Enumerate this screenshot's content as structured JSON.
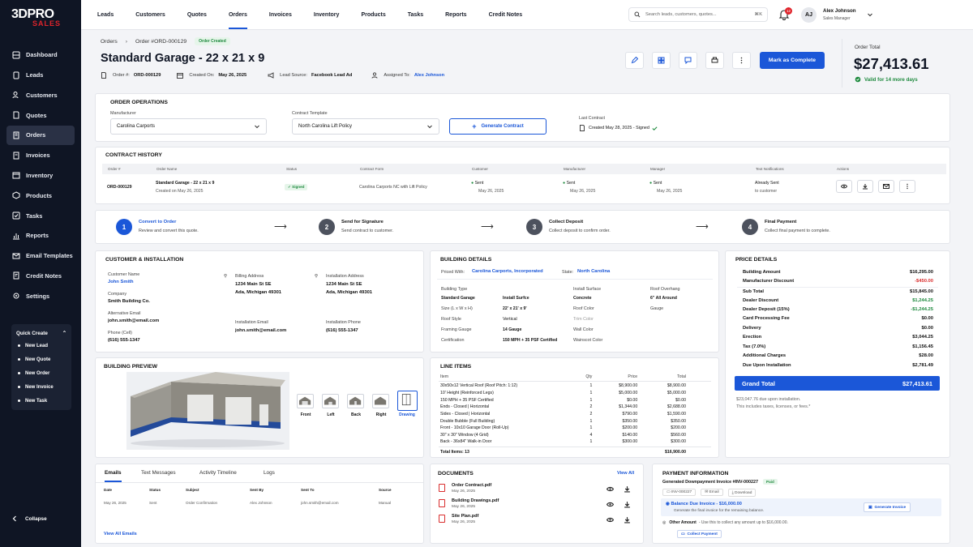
{
  "sidebar": {
    "logo_main": "3DPRO",
    "logo_sub": "SALES",
    "items": [
      {
        "label": "Dashboard",
        "icon": "dashboard-icon"
      },
      {
        "label": "Leads",
        "icon": "leads-icon"
      },
      {
        "label": "Customers",
        "icon": "customers-icon"
      },
      {
        "label": "Quotes",
        "icon": "quotes-icon"
      },
      {
        "label": "Orders",
        "icon": "orders-icon",
        "active": true
      },
      {
        "label": "Invoices",
        "icon": "invoices-icon"
      },
      {
        "label": "Inventory",
        "icon": "inventory-icon"
      },
      {
        "label": "Products",
        "icon": "products-icon"
      },
      {
        "label": "Tasks",
        "icon": "tasks-icon"
      },
      {
        "label": "Reports",
        "icon": "reports-icon"
      },
      {
        "label": "Email Templates",
        "icon": "email-templates-icon"
      },
      {
        "label": "Credit Notes",
        "icon": "credit-notes-icon"
      },
      {
        "label": "Settings",
        "icon": "settings-icon"
      }
    ],
    "quick_create": {
      "title": "Quick Create",
      "items": [
        "New Lead",
        "New Quote",
        "New Order",
        "New Invoice",
        "New Task"
      ]
    },
    "collapse_label": "Collapse"
  },
  "topnav": {
    "items": [
      "Leads",
      "Customers",
      "Quotes",
      "Orders",
      "Invoices",
      "Inventory",
      "Products",
      "Tasks",
      "Reports",
      "Credit Notes"
    ],
    "active": "Orders"
  },
  "search": {
    "placeholder": "Search leads, customers, quotes...",
    "shortcut": "⌘K"
  },
  "notifications": {
    "count": "12"
  },
  "user": {
    "initials": "AJ",
    "name": "Alex Johnson",
    "role": "Sales Manager"
  },
  "breadcrumb": {
    "root": "Orders",
    "current": "Order #ORD-000129",
    "status": "Order Created"
  },
  "order": {
    "title": "Standard Garage - 22 x 21 x 9",
    "number_label": "Order #:",
    "number": "ORD-000129",
    "created_label": "Created On:",
    "created": "May 26, 2025",
    "source_label": "Lead Source:",
    "source": "Facebook Lead Ad",
    "assigned_label": "Assigned To:",
    "assigned": "Alex Johnson",
    "mark_complete": "Mark as Complete"
  },
  "order_total": {
    "label": "Order Total",
    "value": "$27,413.61",
    "valid": "Valid for 14 more days"
  },
  "operations": {
    "title": "ORDER OPERATIONS",
    "manufacturer_label": "Manufacturer",
    "manufacturer": "Carolina Carports",
    "template_label": "Contract Template",
    "template": "North Carolina Lift Policy",
    "generate": "Generate Contract",
    "last_label": "Last Contract",
    "last": "Created May 28, 2025 - Signed"
  },
  "contract_history": {
    "title": "CONTRACT HISTORY",
    "headers": [
      "Order #",
      "Order Name",
      "Status",
      "Contract Form",
      "Customer",
      "Manufacturer",
      "Manager",
      "Text Notifications",
      "Actions"
    ],
    "row": {
      "order": "ORD-000129",
      "name": "Standard Garage - 22 x 21 x 9",
      "name_date": "Created on May 26, 2025",
      "status": "Signed",
      "form": "Carolina Carports NC with Lift Policy",
      "customer": "Sent",
      "customer_date": "May 26, 2025",
      "manufacturer": "Sent",
      "manufacturer_date": "May 26, 2025",
      "manager": "Sent",
      "manager_date": "May 26, 2025",
      "notif": "Already Sent",
      "notif_sub": "to customer"
    }
  },
  "steps": [
    {
      "n": "1",
      "title": "Convert to Order",
      "sub": "Review and convert this quote."
    },
    {
      "n": "2",
      "title": "Send for Signature",
      "sub": "Send contract to customer."
    },
    {
      "n": "3",
      "title": "Collect Deposit",
      "sub": "Collect deposit to confirm order."
    },
    {
      "n": "4",
      "title": "Final Payment",
      "sub": "Collect final payment to complete."
    }
  ],
  "customer": {
    "title": "CUSTOMER & INSTALLATION",
    "name_label": "Customer Name",
    "name": "John Smith",
    "company_label": "Company",
    "company": "Smith Building Co.",
    "alt_email_label": "Alternative Email",
    "alt_email": "john.smith@email.com",
    "phone_label": "Phone (Cell)",
    "phone": "(616) 555-1347",
    "billing_label": "Billing Address",
    "billing_1": "1234 Main St SE",
    "billing_2": "Ada, Michigan 49301",
    "install_label": "Installation Address",
    "install_1": "1234 Main St SE",
    "install_2": "Ada, Michigan 49301",
    "install_email_label": "Installation Email",
    "install_email": "john.smith@email.com",
    "install_phone_label": "Installation Phone",
    "install_phone": "(616) 555-1347"
  },
  "building": {
    "title": "BUILDING DETAILS",
    "priced_label": "Priced With:",
    "priced": "Carolina Carports, Incorporated",
    "state_label": "State:",
    "state": "North Carolina",
    "type_label": "Building Type",
    "type": "Standard Garage",
    "size_label": "Size (L x W x H)",
    "size": "22' x 21' x 9'",
    "roof_label": "Roof Style",
    "roof": "Vertical",
    "gauge_label": "Framing Gauge",
    "gauge": "14 Gauge",
    "cert_label": "Certification",
    "cert": "150 MPH + 35 PSF Certified",
    "surface_label": "Install Surface",
    "surface": "Concrete",
    "roofcolor_label": "Roof Color",
    "trim_label": "Trim Color",
    "wall_label": "Wall Color",
    "wainscot_label": "Wainscot Color",
    "overhang_label": "Roof Overhang",
    "overhang": "6\" All Around",
    "gauge2": "Gauge"
  },
  "price": {
    "title": "PRICE DETAILS",
    "rows": [
      {
        "k": "Building Amount",
        "v": "$16,295.00",
        "c": ""
      },
      {
        "k": "Manufacturer Discount",
        "v": "-$450.00",
        "c": "neg"
      },
      {
        "k": "Sub Total",
        "v": "$15,845.00",
        "c": ""
      },
      {
        "k": "Dealer Discount",
        "v": "$1,244.25",
        "c": "pos"
      },
      {
        "k": "Dealer Deposit (15%)",
        "v": "-$1,244.25",
        "c": "pos"
      },
      {
        "k": "Card Processing Fee",
        "v": "$0.00",
        "c": ""
      },
      {
        "k": "Delivery",
        "v": "$0.00",
        "c": ""
      },
      {
        "k": "Erection",
        "v": "$3,044.25",
        "c": ""
      },
      {
        "k": "Tax (7.0%)",
        "v": "$1,156.45",
        "c": ""
      },
      {
        "k": "Additional Charges",
        "v": "$28.00",
        "c": ""
      },
      {
        "k": "Due Upon Installation",
        "v": "$2,781.49",
        "c": ""
      }
    ],
    "grand_label": "Grand Total",
    "grand": "$27,413.61",
    "note1": "$23,047.76 due upon installation.",
    "note2": "This includes taxes, licenses, or fees.*"
  },
  "preview": {
    "title": "BUILDING PREVIEW",
    "views": [
      "Front",
      "Left",
      "Back",
      "Right",
      "Drawing"
    ]
  },
  "line_items": {
    "title": "LINE ITEMS",
    "headers": [
      "Item",
      "Qty",
      "Price",
      "Total"
    ],
    "rows": [
      [
        "30x50x12 Vertical Roof (Roof Pitch: 1:12)",
        "1",
        "$8,900.00",
        "$8,900.00"
      ],
      [
        "10' Height (Reinforced Legs)",
        "1",
        "$5,000.00",
        "$5,000.00"
      ],
      [
        "150 MPH + 35 PSF Certified",
        "1",
        "$0.00",
        "$0.00"
      ],
      [
        "Ends - Closed | Horizontal",
        "2",
        "$1,344.00",
        "$2,688.00"
      ],
      [
        "Sides - Closed | Horizontal",
        "2",
        "$790.00",
        "$1,590.00"
      ],
      [
        "Double Bubble (Full Building)",
        "1",
        "$350.00",
        "$350.00"
      ],
      [
        "Front - 10x10 Garage Door (Roll-Up)",
        "1",
        "$200.00",
        "$200.00"
      ],
      [
        "30\" x 30\" Window (4 Grid)",
        "4",
        "$140.00",
        "$560.00"
      ],
      [
        "Back - 36x84\" Walk-in Door",
        "1",
        "$300.00",
        "$300.00"
      ]
    ],
    "total_items": "Total Items: 13",
    "total": "$16,900.00"
  },
  "activity": {
    "tabs": [
      "Emails",
      "Text Messages",
      "Activity Timeline",
      "Logs"
    ],
    "headers": [
      "Date",
      "Status",
      "Subject",
      "Sent By",
      "Sent To",
      "Source"
    ],
    "row": [
      "May 26, 2025",
      "Sent",
      "Order Confirmation",
      "Alex Johnson",
      "john.smith@email.com",
      "Manual"
    ],
    "view_all": "View All Emails"
  },
  "documents": {
    "title": "DOCUMENTS",
    "view_all": "View All",
    "items": [
      {
        "name": "Order Contract.pdf",
        "date": "May 26, 2025"
      },
      {
        "name": "Building Drawings.pdf",
        "date": "May 26, 2025"
      },
      {
        "name": "Site Plan.pdf",
        "date": "May 26, 2025"
      }
    ]
  },
  "payment": {
    "title": "PAYMENT INFORMATION",
    "invoice": "Generated Downpayment Invoice #INV-000227",
    "invoice_status": "Paid",
    "inv_id": "INV-000227",
    "email_label": "Email",
    "download_label": "Download",
    "balance": "Balance Due Invoice - $16,000.00",
    "balance_sub": "Generate the final invoice for the remaining balance.",
    "generate": "Generate Invoice",
    "other": "Other Amount",
    "other_sub": "- Use this to collect any amount up to $16,000.00.",
    "collect": "Collect Payment"
  }
}
